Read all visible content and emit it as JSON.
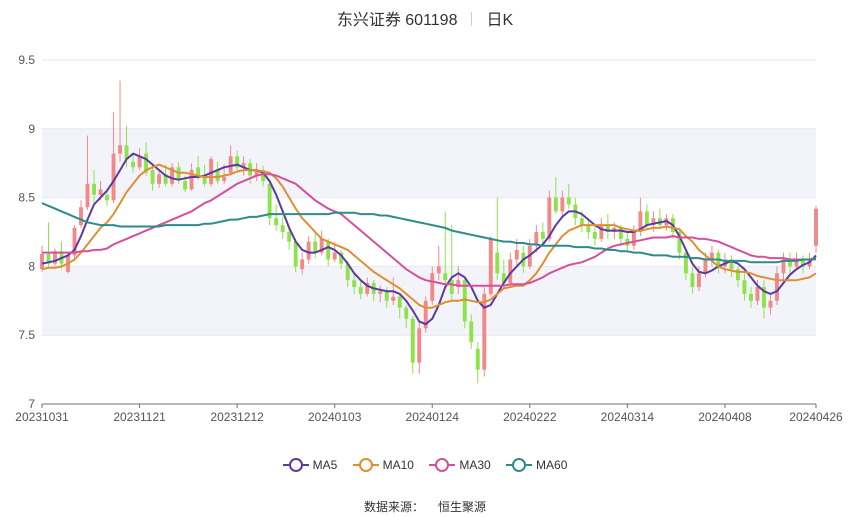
{
  "header": {
    "stock": "东兴证券 601198",
    "period": "日K"
  },
  "source": {
    "label": "数据来源：",
    "value": "恒生聚源"
  },
  "colors": {
    "up": "#ef8a8a",
    "down": "#8ee34c",
    "grid": "#e6e6ee",
    "band": "#f3f4f9",
    "axis": "#555555"
  },
  "chart_data": {
    "type": "candlestick",
    "title": "东兴证券 601198",
    "ylim": [
      7,
      9.5
    ],
    "y_ticks": [
      7,
      7.5,
      8,
      8.5,
      9,
      9.5
    ],
    "y_tick_labels": [
      "7",
      "7.5",
      "8",
      "8.5",
      "9",
      "9.5"
    ],
    "x_tick_labels": [
      "20231031",
      "20231121",
      "20231212",
      "20240103",
      "20240124",
      "20240222",
      "20240314",
      "20240408",
      "20240426"
    ],
    "x_tick_index": [
      0,
      15,
      30,
      45,
      60,
      75,
      90,
      105,
      119
    ],
    "legend_position": "bottom",
    "candles": [
      [
        7.98,
        8.09,
        8.15,
        7.96
      ],
      [
        8.09,
        8.02,
        8.32,
        8.0
      ],
      [
        8.02,
        8.11,
        8.13,
        8.0
      ],
      [
        8.11,
        8.02,
        8.18,
        7.98
      ],
      [
        7.96,
        8.08,
        8.1,
        7.95
      ],
      [
        8.08,
        8.28,
        8.3,
        8.06
      ],
      [
        8.3,
        8.43,
        8.48,
        8.28
      ],
      [
        8.43,
        8.6,
        8.95,
        8.41
      ],
      [
        8.6,
        8.52,
        8.7,
        8.45
      ],
      [
        8.52,
        8.56,
        8.62,
        8.48
      ],
      [
        8.52,
        8.48,
        8.56,
        8.44
      ],
      [
        8.48,
        8.82,
        9.12,
        8.46
      ],
      [
        8.82,
        8.88,
        9.35,
        8.76
      ],
      [
        8.88,
        8.78,
        9.02,
        8.72
      ],
      [
        8.76,
        8.72,
        8.82,
        8.68
      ],
      [
        8.72,
        8.8,
        8.86,
        8.7
      ],
      [
        8.82,
        8.68,
        8.9,
        8.66
      ],
      [
        8.7,
        8.6,
        8.74,
        8.55
      ],
      [
        8.6,
        8.67,
        8.7,
        8.57
      ],
      [
        8.67,
        8.6,
        8.74,
        8.58
      ],
      [
        8.6,
        8.72,
        8.75,
        8.58
      ],
      [
        8.72,
        8.63,
        8.76,
        8.6
      ],
      [
        8.62,
        8.56,
        8.66,
        8.54
      ],
      [
        8.56,
        8.7,
        8.75,
        8.55
      ],
      [
        8.72,
        8.66,
        8.8,
        8.63
      ],
      [
        8.66,
        8.6,
        8.74,
        8.58
      ],
      [
        8.6,
        8.78,
        8.8,
        8.58
      ],
      [
        8.7,
        8.62,
        8.76,
        8.6
      ],
      [
        8.62,
        8.65,
        8.74,
        8.6
      ],
      [
        8.68,
        8.8,
        8.88,
        8.66
      ],
      [
        8.8,
        8.72,
        8.84,
        8.7
      ],
      [
        8.72,
        8.75,
        8.8,
        8.66
      ],
      [
        8.75,
        8.66,
        8.78,
        8.6
      ],
      [
        8.66,
        8.7,
        8.75,
        8.62
      ],
      [
        8.7,
        8.62,
        8.73,
        8.58
      ],
      [
        8.6,
        8.35,
        8.62,
        8.3
      ],
      [
        8.35,
        8.3,
        8.45,
        8.26
      ],
      [
        8.3,
        8.25,
        8.36,
        8.2
      ],
      [
        8.25,
        8.18,
        8.3,
        8.12
      ],
      [
        8.18,
        8.0,
        8.2,
        7.96
      ],
      [
        7.98,
        8.05,
        8.1,
        7.94
      ],
      [
        8.05,
        8.18,
        8.22,
        8.02
      ],
      [
        8.18,
        8.1,
        8.24,
        8.06
      ],
      [
        8.1,
        8.2,
        8.26,
        8.08
      ],
      [
        8.18,
        8.05,
        8.2,
        8.0
      ],
      [
        8.05,
        8.1,
        8.18,
        8.03
      ],
      [
        8.1,
        8.02,
        8.12,
        7.98
      ],
      [
        8.02,
        7.9,
        8.04,
        7.85
      ],
      [
        7.9,
        7.85,
        7.95,
        7.8
      ],
      [
        7.85,
        7.8,
        7.9,
        7.76
      ],
      [
        7.8,
        7.88,
        7.92,
        7.78
      ],
      [
        7.88,
        7.8,
        7.9,
        7.75
      ],
      [
        7.8,
        7.82,
        7.86,
        7.74
      ],
      [
        7.82,
        7.75,
        7.85,
        7.7
      ],
      [
        7.75,
        7.78,
        7.92,
        7.72
      ],
      [
        7.78,
        7.7,
        7.8,
        7.62
      ],
      [
        7.7,
        7.62,
        7.72,
        7.55
      ],
      [
        7.62,
        7.3,
        7.64,
        7.22
      ],
      [
        7.3,
        7.55,
        7.6,
        7.22
      ],
      [
        7.55,
        7.75,
        7.78,
        7.52
      ],
      [
        7.75,
        7.95,
        8.0,
        7.72
      ],
      [
        7.95,
        8.0,
        8.15,
        7.9
      ],
      [
        7.95,
        7.9,
        8.4,
        7.85
      ],
      [
        7.9,
        7.8,
        8.3,
        7.75
      ],
      [
        7.85,
        7.9,
        8.0,
        7.8
      ],
      [
        7.9,
        7.6,
        7.92,
        7.55
      ],
      [
        7.6,
        7.45,
        7.65,
        7.4
      ],
      [
        7.4,
        7.25,
        7.45,
        7.15
      ],
      [
        7.25,
        7.8,
        7.85,
        7.2
      ],
      [
        7.8,
        8.2,
        8.22,
        7.78
      ],
      [
        8.1,
        7.95,
        8.5,
        7.9
      ],
      [
        7.95,
        7.88,
        8.05,
        7.85
      ],
      [
        7.88,
        8.05,
        8.1,
        7.85
      ],
      [
        8.05,
        8.12,
        8.2,
        8.0
      ],
      [
        8.1,
        8.0,
        8.15,
        7.95
      ],
      [
        8.0,
        8.15,
        8.2,
        7.98
      ],
      [
        8.15,
        8.25,
        8.3,
        8.1
      ],
      [
        8.25,
        8.2,
        8.32,
        8.15
      ],
      [
        8.2,
        8.5,
        8.55,
        8.18
      ],
      [
        8.5,
        8.4,
        8.65,
        8.38
      ],
      [
        8.4,
        8.5,
        8.55,
        8.35
      ],
      [
        8.5,
        8.45,
        8.6,
        8.42
      ],
      [
        8.45,
        8.35,
        8.5,
        8.3
      ],
      [
        8.35,
        8.3,
        8.4,
        8.25
      ],
      [
        8.3,
        8.25,
        8.35,
        8.2
      ],
      [
        8.25,
        8.2,
        8.3,
        8.15
      ],
      [
        8.2,
        8.3,
        8.35,
        8.18
      ],
      [
        8.3,
        8.25,
        8.38,
        8.2
      ],
      [
        8.25,
        8.28,
        8.32,
        8.2
      ],
      [
        8.28,
        8.2,
        8.3,
        8.15
      ],
      [
        8.2,
        8.15,
        8.25,
        8.12
      ],
      [
        8.15,
        8.25,
        8.3,
        8.12
      ],
      [
        8.25,
        8.4,
        8.5,
        8.22
      ],
      [
        8.4,
        8.3,
        8.45,
        8.28
      ],
      [
        8.3,
        8.35,
        8.4,
        8.25
      ],
      [
        8.35,
        8.3,
        8.42,
        8.28
      ],
      [
        8.3,
        8.35,
        8.38,
        8.26
      ],
      [
        8.35,
        8.25,
        8.38,
        8.2
      ],
      [
        8.25,
        8.1,
        8.28,
        8.05
      ],
      [
        8.1,
        7.95,
        8.12,
        7.9
      ],
      [
        7.95,
        7.85,
        8.0,
        7.8
      ],
      [
        7.85,
        7.95,
        8.0,
        7.82
      ],
      [
        7.95,
        8.05,
        8.1,
        7.92
      ],
      [
        8.05,
        8.1,
        8.15,
        8.0
      ],
      [
        8.1,
        8.0,
        8.12,
        7.95
      ],
      [
        8.0,
        8.05,
        8.1,
        7.95
      ],
      [
        8.05,
        7.98,
        8.08,
        7.92
      ],
      [
        7.98,
        7.9,
        8.0,
        7.85
      ],
      [
        7.9,
        7.8,
        7.95,
        7.75
      ],
      [
        7.8,
        7.75,
        7.85,
        7.7
      ],
      [
        7.75,
        7.85,
        7.9,
        7.72
      ],
      [
        7.85,
        7.7,
        7.9,
        7.62
      ],
      [
        7.7,
        7.75,
        7.8,
        7.65
      ],
      [
        7.75,
        7.95,
        8.0,
        7.72
      ],
      [
        7.95,
        8.05,
        8.1,
        7.9
      ],
      [
        8.05,
        8.0,
        8.1,
        7.95
      ],
      [
        8.0,
        8.05,
        8.1,
        7.98
      ],
      [
        8.05,
        8.0,
        8.08,
        7.95
      ],
      [
        8.0,
        8.05,
        8.1,
        7.98
      ],
      [
        8.15,
        8.42,
        8.44,
        8.1
      ]
    ],
    "series": [
      {
        "name": "MA5",
        "color": "#5c3aa0",
        "values": [
          8.02,
          8.03,
          8.04,
          8.06,
          8.08,
          8.12,
          8.22,
          8.34,
          8.45,
          8.5,
          8.55,
          8.62,
          8.7,
          8.78,
          8.82,
          8.8,
          8.78,
          8.74,
          8.7,
          8.66,
          8.64,
          8.63,
          8.64,
          8.65,
          8.65,
          8.66,
          8.68,
          8.7,
          8.72,
          8.73,
          8.74,
          8.72,
          8.7,
          8.7,
          8.68,
          8.62,
          8.52,
          8.4,
          8.28,
          8.18,
          8.12,
          8.1,
          8.1,
          8.12,
          8.14,
          8.12,
          8.08,
          8.02,
          7.95,
          7.9,
          7.86,
          7.84,
          7.83,
          7.82,
          7.82,
          7.8,
          7.75,
          7.68,
          7.6,
          7.58,
          7.62,
          7.72,
          7.85,
          7.92,
          7.95,
          7.92,
          7.85,
          7.75,
          7.7,
          7.72,
          7.8,
          7.88,
          7.95,
          8.0,
          8.05,
          8.08,
          8.12,
          8.16,
          8.22,
          8.3,
          8.36,
          8.4,
          8.4,
          8.38,
          8.34,
          8.3,
          8.27,
          8.26,
          8.26,
          8.26,
          8.25,
          8.25,
          8.27,
          8.3,
          8.31,
          8.32,
          8.33,
          8.3,
          8.22,
          8.12,
          8.02,
          7.96,
          7.95,
          7.97,
          8.0,
          8.02,
          8.04,
          8.02,
          7.98,
          7.92,
          7.86,
          7.82,
          7.8,
          7.82,
          7.88,
          7.94,
          7.98,
          8.01,
          8.03,
          8.08
        ]
      },
      {
        "name": "MA10",
        "color": "#e08e35",
        "values": [
          7.98,
          7.99,
          7.99,
          8.0,
          8.02,
          8.05,
          8.1,
          8.16,
          8.22,
          8.28,
          8.32,
          8.38,
          8.46,
          8.54,
          8.6,
          8.66,
          8.7,
          8.72,
          8.74,
          8.72,
          8.7,
          8.68,
          8.68,
          8.67,
          8.66,
          8.65,
          8.65,
          8.65,
          8.66,
          8.67,
          8.69,
          8.7,
          8.7,
          8.7,
          8.69,
          8.68,
          8.64,
          8.58,
          8.5,
          8.42,
          8.35,
          8.3,
          8.25,
          8.2,
          8.18,
          8.16,
          8.14,
          8.12,
          8.08,
          8.04,
          8.0,
          7.96,
          7.93,
          7.9,
          7.87,
          7.84,
          7.8,
          7.76,
          7.72,
          7.7,
          7.7,
          7.72,
          7.74,
          7.75,
          7.75,
          7.76,
          7.75,
          7.74,
          7.74,
          7.76,
          7.8,
          7.84,
          7.85,
          7.86,
          7.86,
          7.9,
          7.95,
          8.02,
          8.1,
          8.16,
          8.22,
          8.26,
          8.28,
          8.3,
          8.3,
          8.3,
          8.3,
          8.3,
          8.3,
          8.28,
          8.27,
          8.26,
          8.26,
          8.27,
          8.28,
          8.28,
          8.29,
          8.28,
          8.27,
          8.22,
          8.18,
          8.12,
          8.08,
          8.04,
          8.0,
          7.98,
          7.97,
          7.96,
          7.96,
          7.95,
          7.93,
          7.92,
          7.91,
          7.9,
          7.9,
          7.9,
          7.9,
          7.91,
          7.92,
          7.95
        ]
      },
      {
        "name": "MA30",
        "color": "#d4509f",
        "values": [
          8.1,
          8.1,
          8.1,
          8.1,
          8.1,
          8.1,
          8.11,
          8.11,
          8.12,
          8.12,
          8.13,
          8.16,
          8.18,
          8.2,
          8.22,
          8.24,
          8.26,
          8.28,
          8.3,
          8.32,
          8.34,
          8.36,
          8.38,
          8.4,
          8.43,
          8.46,
          8.48,
          8.51,
          8.54,
          8.57,
          8.6,
          8.62,
          8.64,
          8.66,
          8.67,
          8.67,
          8.66,
          8.64,
          8.62,
          8.6,
          8.56,
          8.52,
          8.48,
          8.45,
          8.42,
          8.4,
          8.38,
          8.34,
          8.3,
          8.26,
          8.22,
          8.18,
          8.14,
          8.1,
          8.06,
          8.02,
          7.98,
          7.95,
          7.92,
          7.9,
          7.89,
          7.88,
          7.87,
          7.87,
          7.86,
          7.86,
          7.86,
          7.86,
          7.86,
          7.86,
          7.86,
          7.86,
          7.87,
          7.87,
          7.87,
          7.88,
          7.9,
          7.92,
          7.95,
          7.97,
          7.99,
          8.01,
          8.02,
          8.03,
          8.05,
          8.07,
          8.1,
          8.13,
          8.15,
          8.16,
          8.17,
          8.18,
          8.19,
          8.2,
          8.21,
          8.21,
          8.21,
          8.22,
          8.21,
          8.21,
          8.21,
          8.2,
          8.2,
          8.19,
          8.18,
          8.16,
          8.14,
          8.12,
          8.1,
          8.08,
          8.07,
          8.07,
          8.06,
          8.06,
          8.06,
          8.05,
          8.05,
          8.05,
          8.05,
          8.05
        ]
      },
      {
        "name": "MA60",
        "color": "#2e8b8b",
        "values": [
          8.46,
          8.44,
          8.42,
          8.4,
          8.38,
          8.36,
          8.34,
          8.32,
          8.31,
          8.3,
          8.3,
          8.3,
          8.29,
          8.29,
          8.29,
          8.29,
          8.29,
          8.29,
          8.29,
          8.3,
          8.3,
          8.3,
          8.3,
          8.3,
          8.3,
          8.31,
          8.31,
          8.32,
          8.33,
          8.34,
          8.34,
          8.35,
          8.36,
          8.36,
          8.37,
          8.38,
          8.38,
          8.38,
          8.38,
          8.38,
          8.38,
          8.38,
          8.38,
          8.38,
          8.38,
          8.39,
          8.39,
          8.39,
          8.39,
          8.38,
          8.38,
          8.38,
          8.37,
          8.37,
          8.36,
          8.35,
          8.34,
          8.33,
          8.32,
          8.31,
          8.3,
          8.29,
          8.28,
          8.26,
          8.25,
          8.24,
          8.23,
          8.22,
          8.21,
          8.2,
          8.19,
          8.18,
          8.18,
          8.17,
          8.17,
          8.16,
          8.16,
          8.15,
          8.15,
          8.15,
          8.15,
          8.15,
          8.14,
          8.14,
          8.14,
          8.13,
          8.13,
          8.12,
          8.12,
          8.11,
          8.11,
          8.1,
          8.1,
          8.09,
          8.08,
          8.08,
          8.08,
          8.07,
          8.07,
          8.07,
          8.06,
          8.06,
          8.05,
          8.05,
          8.05,
          8.04,
          8.04,
          8.04,
          8.04,
          8.03,
          8.03,
          8.03,
          8.03,
          8.03,
          8.04,
          8.04,
          8.04,
          8.05,
          8.05,
          8.06
        ]
      }
    ]
  }
}
